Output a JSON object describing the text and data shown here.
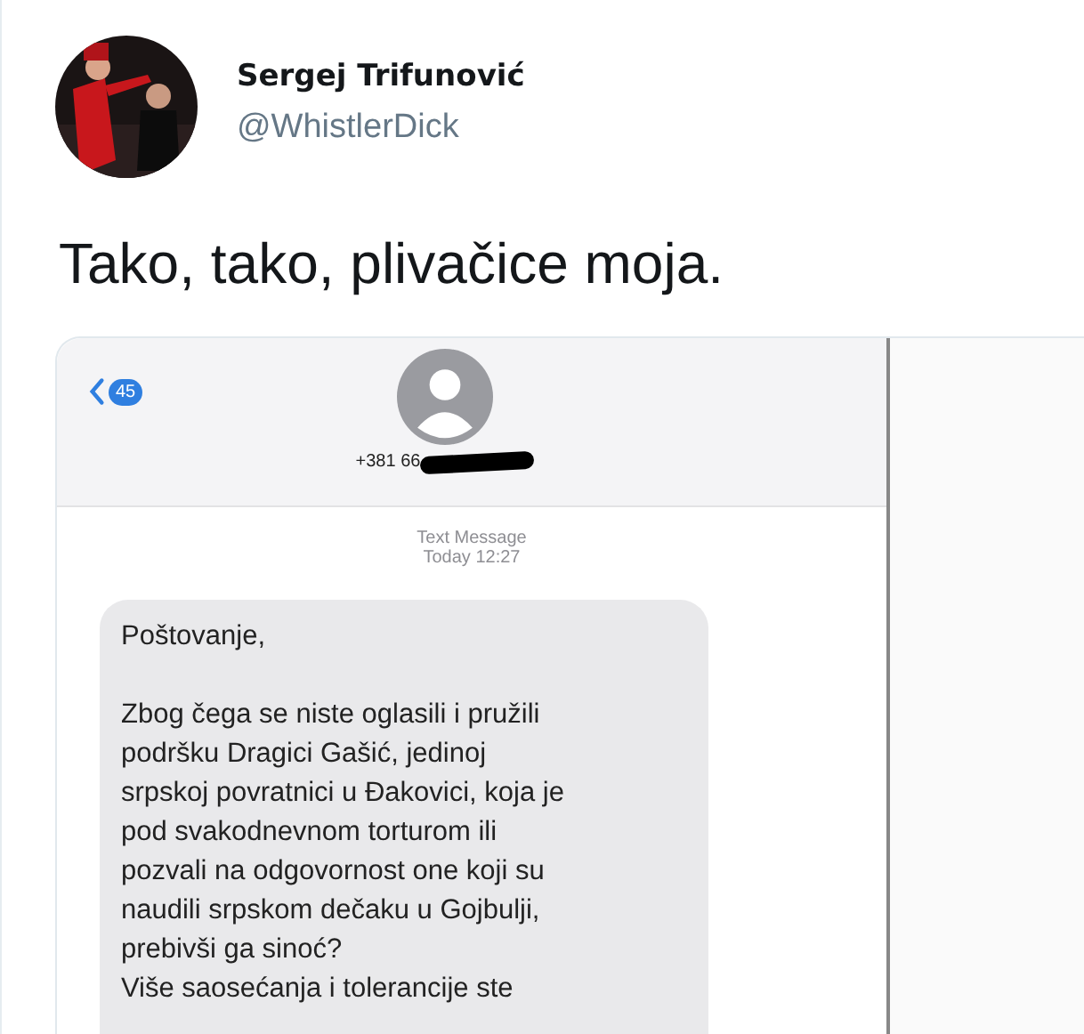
{
  "tweet": {
    "author": {
      "name": "Sergej Trifunović",
      "handle": "@WhistlerDick"
    },
    "text": "Tako, tako, plivačice moja.",
    "media": {
      "header": {
        "back_count": "45",
        "phone": "+381 66",
        "redacted": true
      },
      "timestamp": {
        "label": "Text Message",
        "time": "Today 12:27"
      },
      "message": {
        "paragraphs": [
          "Poštovanje,",
          "Zbog čega se niste oglasili i pružili\npodršku Dragici Gašić, jedinoj\nsrpskoj povratnici u Đakovici, koja je\npod svakodnevnom torturom ili\npozvali na odgovornost one koji su\nnaudili srpskom dečaku u Gojbulji,\nprebivši ga sinoć?\nViše saosećanja i tolerancije ste"
        ]
      }
    }
  }
}
